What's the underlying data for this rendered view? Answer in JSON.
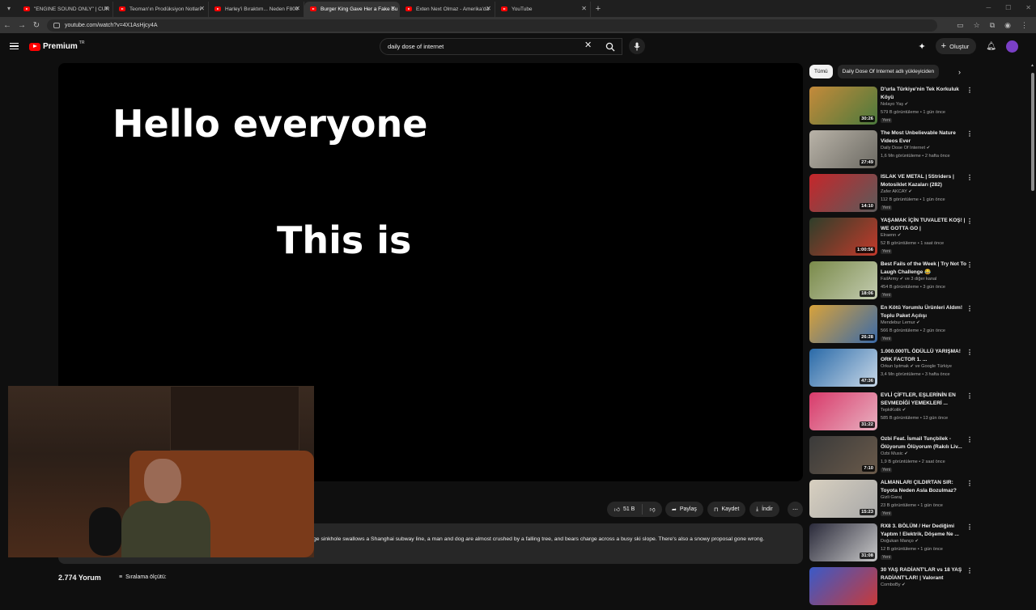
{
  "browser": {
    "tabs": [
      {
        "title": "\"ENGINE SOUND ONLY\" | CUR",
        "active": false
      },
      {
        "title": "Teoman'ın Prodüksiyon Notları",
        "active": false
      },
      {
        "title": "Harley'i Bıraktım... Neden F800",
        "active": false
      },
      {
        "title": "Burger King Gave Her a Fake Bu",
        "active": true
      },
      {
        "title": "Exten Next Olmaz - Amerika'da",
        "active": false
      },
      {
        "title": "YouTube",
        "active": false
      }
    ],
    "url": "youtube.com/watch?v=4X1AsHjcy4A"
  },
  "header": {
    "logo_text": "Premium",
    "region": "TR",
    "search_value": "daily dose of internet",
    "create_label": "Oluştur"
  },
  "video": {
    "text_line1": "Hello everyone",
    "text_line2": "This is"
  },
  "actions": {
    "like_count": "51 B",
    "share": "Paylaş",
    "save": "Kaydet",
    "download": "İndir"
  },
  "description": {
    "text": "ge sinkhole swallows a Shanghai subway line, a man and dog are almost crushed by a falling tree, and bears charge across a busy ski slope. There's also a snowy proposal gone wrong."
  },
  "comments": {
    "count_label": "2.774 Yorum",
    "sort_label": "Sıralama ölçütü:"
  },
  "chips": [
    "Tümü",
    "Daily Dose Of Internet adlı yükleyiciden"
  ],
  "recommendations": [
    {
      "title": "D'urla Türkiye'nin Tek  Korkuluk Köyü",
      "channel": "Nolayo Yaş",
      "verified": true,
      "meta": "579 B görüntüleme • 1 gün önce",
      "badge": "Yeni",
      "duration": "30:26",
      "thumb": [
        "#c58a3a",
        "#4b7a3c"
      ]
    },
    {
      "title": "The Most Unbelievable Nature Videos Ever",
      "channel": "Daily Dose Of Internet",
      "verified": true,
      "meta": "1,6 Mn görüntüleme • 2 hafta önce",
      "badge": "",
      "duration": "27:49",
      "thumb": [
        "#b9b3a8",
        "#6c6a63"
      ]
    },
    {
      "title": "ISLAK VE METAL | 5Striders | Motosiklet Kazaları (282)",
      "channel": "Zafer AKCAY",
      "verified": true,
      "meta": "112 B görüntüleme • 1 gün önce",
      "badge": "Yeni",
      "duration": "14:10",
      "thumb": [
        "#c6262a",
        "#5b5b5b"
      ]
    },
    {
      "title": "YAŞAMAK İÇİN TUVALETE KOŞ! | WE GOTTA GO |",
      "channel": "Elraenn",
      "verified": true,
      "meta": "52 B görüntüleme • 1 saat önce",
      "badge": "Yeni",
      "duration": "1:00:56",
      "thumb": [
        "#2e3e2a",
        "#c43a2b"
      ]
    },
    {
      "title": "Best Fails of the Week | Try Not To Laugh Challenge 😂",
      "channel": "FailArmy",
      "verified": true,
      "extra": "ve 3 diğer kanal",
      "meta": "454 B görüntüleme • 3 gün önce",
      "badge": "Yeni",
      "duration": "18:06",
      "thumb": [
        "#7a8a4a",
        "#c3ccb0"
      ]
    },
    {
      "title": "En Kötü Yorumlu Ürünleri Aldım! Toplu Paket Açılışı",
      "channel": "Mendebur Lemur",
      "verified": true,
      "meta": "566 B görüntüleme • 2 gün önce",
      "badge": "Yeni",
      "duration": "26:28",
      "thumb": [
        "#d8a23a",
        "#3a6aa8"
      ]
    },
    {
      "title": "1.000.000TL ÖDÜLLÜ YARIŞMA! ORK FACTOR 1. ...",
      "channel": "Orkun Işıtmak",
      "verified": true,
      "extra": "ve Google Türkiye",
      "meta": "3,4 Mn görüntüleme • 3 hafta önce",
      "badge": "",
      "duration": "47:36",
      "thumb": [
        "#2a6aa8",
        "#c8d8e8"
      ]
    },
    {
      "title": "EVLİ ÇİFTLER, EŞLERİNİN EN SEVMEDİĞİ YEMEKLERİ ...",
      "channel": "TepkiKolik",
      "verified": true,
      "meta": "585 B görüntüleme • 13 gün önce",
      "badge": "",
      "duration": "31:22",
      "thumb": [
        "#d83a6a",
        "#e8b0c0"
      ]
    },
    {
      "title": "Ozbi Feat. İsmail Tunçbilek - Ölüyorum Ölüyorum (Rakılı Liv...",
      "channel": "Ozbi Music",
      "verified": true,
      "meta": "1,9 B görüntüleme • 2 saat önce",
      "badge": "Yeni",
      "duration": "7:10",
      "thumb": [
        "#3a3a3a",
        "#6a5a4a"
      ]
    },
    {
      "title": "ALMANLARI ÇILDIRTAN SIR: Toyota Neden Asla Bozulmaz?",
      "channel": "Gizli Garaj",
      "verified": false,
      "meta": "23 B görüntüleme • 1 gün önce",
      "badge": "Yeni",
      "duration": "15:23",
      "thumb": [
        "#d8d0c0",
        "#a8a8a8"
      ]
    },
    {
      "title": "RX8 3. BÖLÜM  / Her Dediğimi Yaptım ! Elektrik, Döşeme Ne ...",
      "channel": "Doğukan Manço",
      "verified": true,
      "meta": "12 B görüntüleme • 1 gün önce",
      "badge": "Yeni",
      "duration": "31:08",
      "thumb": [
        "#2a2a3a",
        "#c8c8c8"
      ]
    },
    {
      "title": "30 YAŞ RADİANT'LAR vs 18 YAŞ RADİANT'LAR! | Valorant",
      "channel": "ComboBy",
      "verified": true,
      "meta": "",
      "badge": "",
      "duration": "",
      "thumb": [
        "#3a5ac8",
        "#c83a3a"
      ]
    }
  ],
  "colors": {
    "youtube_red": "#ff0000",
    "background": "#0f0f0f",
    "surface": "#272727"
  }
}
